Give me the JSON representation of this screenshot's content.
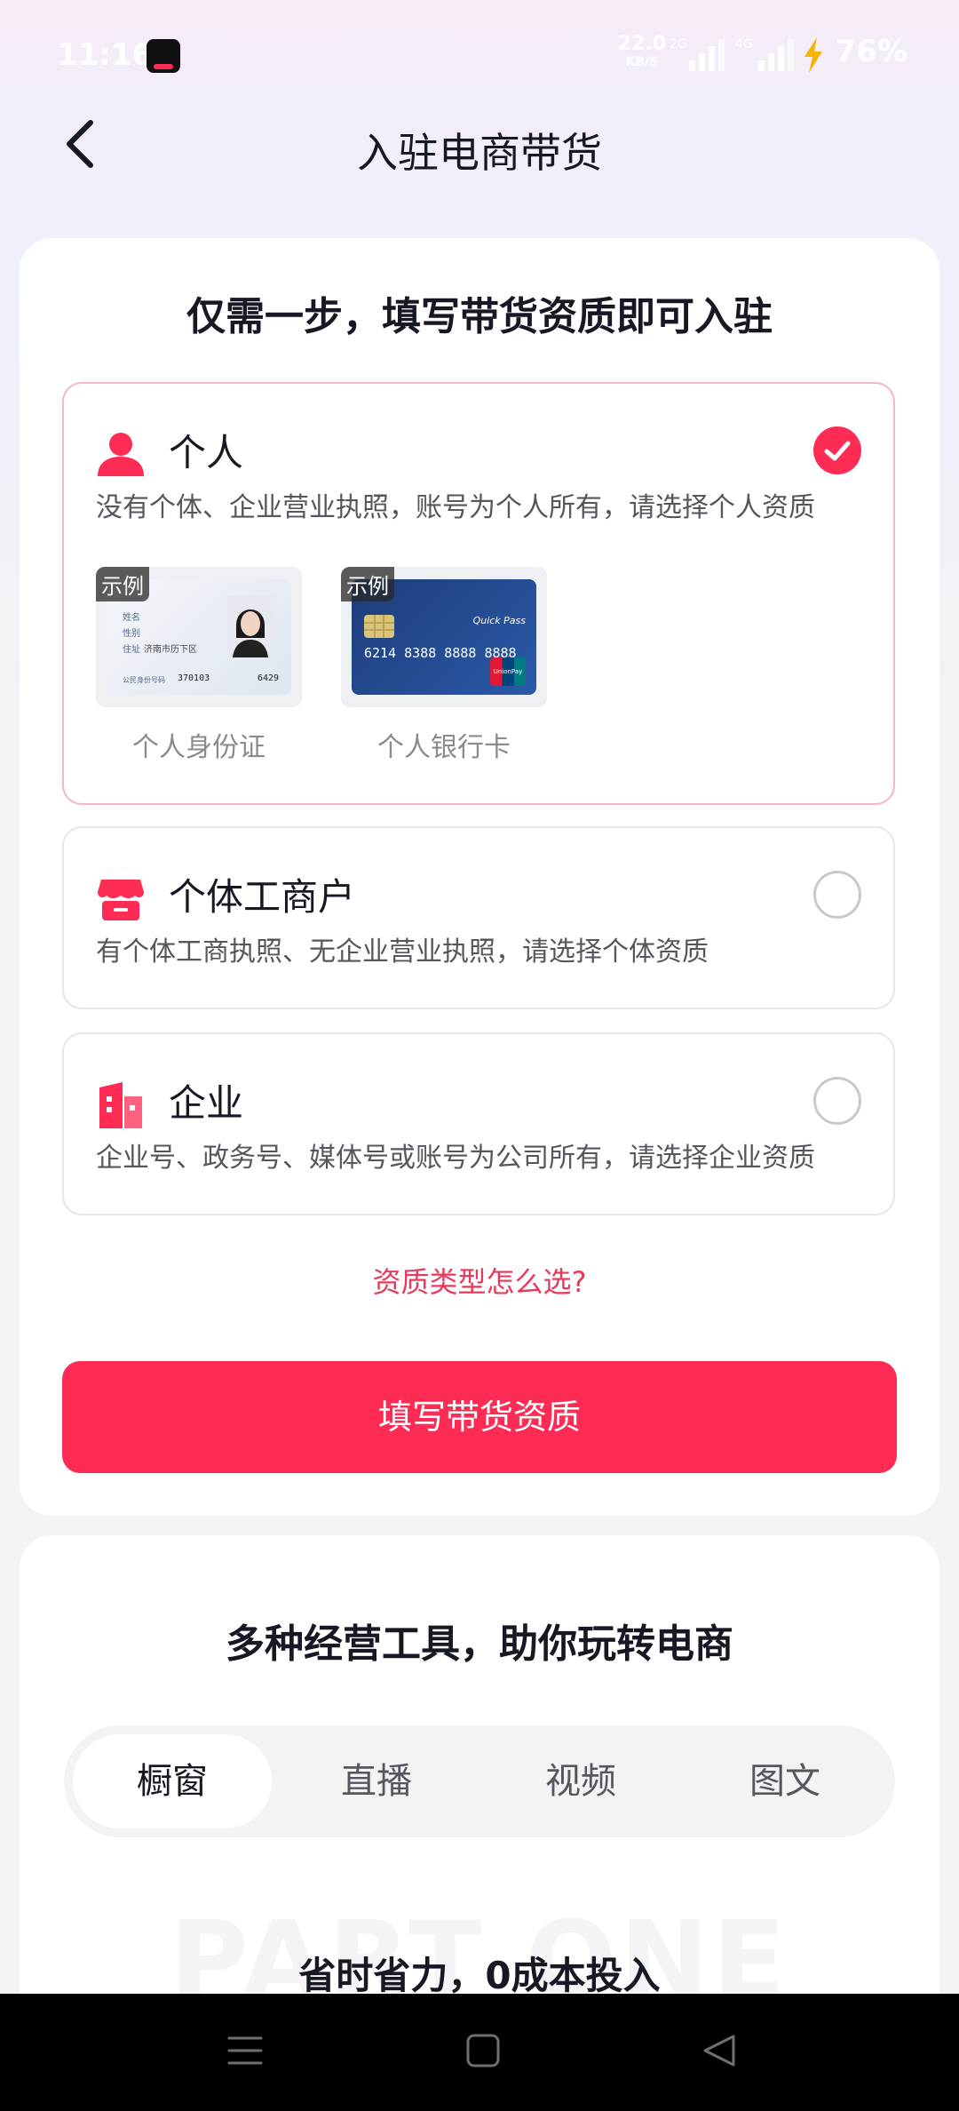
{
  "status_bar": {
    "time": "11:16",
    "net_speed_value": "22.0",
    "net_speed_unit": "KB/S",
    "signal_2g": "2G",
    "signal_4g": "4G",
    "battery": "76%"
  },
  "header": {
    "title": "入驻电商带货"
  },
  "qualification_card": {
    "heading": "仅需一步，填写带货资质即可入驻",
    "options": [
      {
        "title": "个人",
        "desc": "没有个体、企业营业执照，账号为个人所有，请选择个人资质",
        "selected": true,
        "samples": [
          {
            "tag": "示例",
            "caption": "个人身份证"
          },
          {
            "tag": "示例",
            "caption": "个人银行卡"
          }
        ]
      },
      {
        "title": "个体工商户",
        "desc": "有个体工商执照、无企业营业执照，请选择个体资质",
        "selected": false
      },
      {
        "title": "企业",
        "desc": "企业号、政务号、媒体号或账号为公司所有，请选择企业资质",
        "selected": false
      }
    ],
    "help_link": "资质类型怎么选?",
    "submit_button": "填写带货资质"
  },
  "id_card_sample": {
    "row1": "姓名",
    "row2": "性别",
    "row3": "住址",
    "address": "济南市历下区",
    "id_label": "公民身份号码",
    "id_prefix": "370103",
    "id_suffix": "6429"
  },
  "bank_card_sample": {
    "number": "6214  8388  8888  8888",
    "quick_pass": "Quick Pass",
    "union_pay": "UnionPay"
  },
  "tools_card": {
    "heading": "多种经营工具，助你玩转电商",
    "tabs": [
      {
        "label": "橱窗",
        "active": true
      },
      {
        "label": "直播",
        "active": false
      },
      {
        "label": "视频",
        "active": false
      },
      {
        "label": "图文",
        "active": false
      }
    ],
    "section_bg_text": "PART ONE",
    "section_title": "省时省力，0成本投入"
  },
  "colors": {
    "accent": "#fe2c55",
    "link": "#e63a5c",
    "text": "#161823"
  }
}
